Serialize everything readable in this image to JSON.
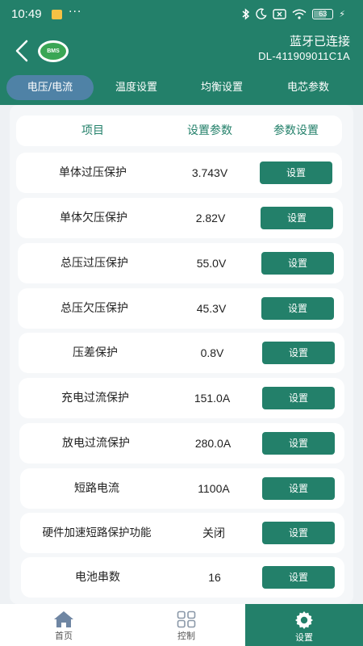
{
  "status_bar": {
    "time": "10:49",
    "dots": "···",
    "battery": "63"
  },
  "header": {
    "bt_status": "蓝牙已连接",
    "device_id": "DL-411909011C1A",
    "logo_text": "BMS"
  },
  "tabs": [
    {
      "label": "电压/电流",
      "active": true
    },
    {
      "label": "温度设置",
      "active": false
    },
    {
      "label": "均衡设置",
      "active": false
    },
    {
      "label": "电芯参数",
      "active": false
    }
  ],
  "table": {
    "headers": [
      "项目",
      "设置参数",
      "参数设置"
    ],
    "button_label": "设置",
    "rows": [
      {
        "name": "单体过压保护",
        "value": "3.743V"
      },
      {
        "name": "单体欠压保护",
        "value": "2.82V"
      },
      {
        "name": "总压过压保护",
        "value": "55.0V"
      },
      {
        "name": "总压欠压保护",
        "value": "45.3V"
      },
      {
        "name": "压差保护",
        "value": "0.8V"
      },
      {
        "name": "充电过流保护",
        "value": "151.0A"
      },
      {
        "name": "放电过流保护",
        "value": "280.0A"
      },
      {
        "name": "短路电流",
        "value": "1100A"
      },
      {
        "name": "硬件加速短路保护功能",
        "value": "关闭"
      },
      {
        "name": "电池串数",
        "value": "16"
      }
    ]
  },
  "bottom_nav": [
    {
      "label": "首页",
      "icon": "home-icon",
      "active": false
    },
    {
      "label": "控制",
      "icon": "grid-icon",
      "active": false
    },
    {
      "label": "设置",
      "icon": "gear-icon",
      "active": true
    }
  ],
  "colors": {
    "primary": "#23806a",
    "active_tab": "#4f82a6",
    "background": "#eef1f4"
  }
}
